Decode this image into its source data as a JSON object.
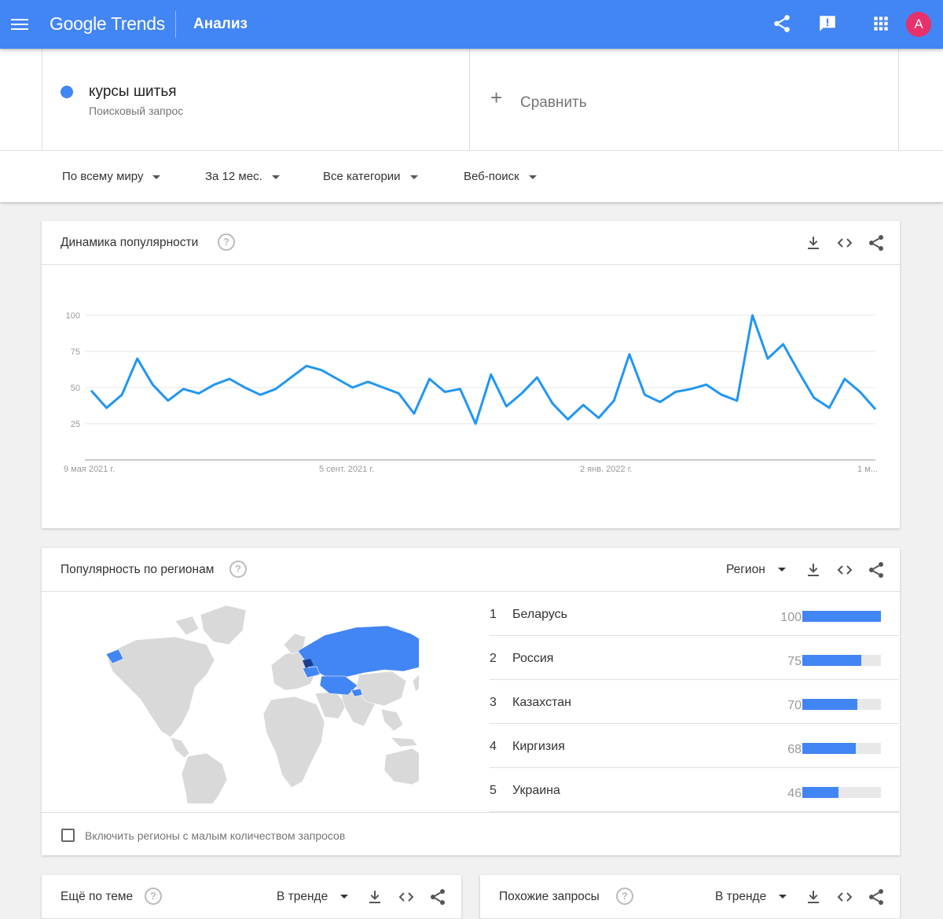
{
  "header": {
    "logo": "Google Trends",
    "section": "Анализ",
    "avatar_letter": "A",
    "icons": [
      "menu-icon",
      "share-icon",
      "feedback-icon",
      "apps-icon"
    ]
  },
  "search": {
    "term": "курсы шитья",
    "term_type": "Поисковый запрос",
    "compare_label": "Сравнить",
    "term_color": "#4285f4"
  },
  "filters": {
    "region": "По всему миру",
    "period": "За 12 мес.",
    "category": "Все категории",
    "search_type": "Веб-поиск"
  },
  "interest_over_time": {
    "title": "Динамика популярности",
    "help": "?",
    "chart_data": {
      "type": "line",
      "ylim": [
        0,
        100
      ],
      "y_ticks": [
        25,
        50,
        75,
        100
      ],
      "x_tick_labels": [
        "9 мая 2021 г.",
        "5 сент. 2021 г.",
        "2 янв. 2022 г.",
        "1 м..."
      ],
      "series": [
        {
          "color": "#2196f3",
          "values": [
            48,
            36,
            45,
            70,
            52,
            41,
            49,
            46,
            52,
            56,
            50,
            45,
            49,
            57,
            65,
            62,
            56,
            50,
            54,
            50,
            46,
            32,
            56,
            47,
            49,
            25,
            59,
            37,
            46,
            57,
            39,
            28,
            38,
            29,
            41,
            73,
            45,
            40,
            47,
            49,
            52,
            45,
            41,
            100,
            70,
            80,
            61,
            43,
            36,
            56,
            47,
            35
          ]
        }
      ]
    }
  },
  "interest_by_region": {
    "title": "Популярность по регионам",
    "help": "?",
    "resolution_label": "Регион",
    "regions": [
      {
        "rank": "1",
        "name": "Беларусь",
        "value": "100",
        "fraction": 1.0
      },
      {
        "rank": "2",
        "name": "Россия",
        "value": "75",
        "fraction": 0.75
      },
      {
        "rank": "3",
        "name": "Казахстан",
        "value": "70",
        "fraction": 0.7
      },
      {
        "rank": "4",
        "name": "Киргизия",
        "value": "68",
        "fraction": 0.68
      },
      {
        "rank": "5",
        "name": "Украина",
        "value": "46",
        "fraction": 0.46
      }
    ],
    "low_volume_label": "Включить регионы с малым количеством запросов",
    "map_colors": {
      "land": "#d9d9d9",
      "highlight": "#4285f4",
      "max": "#1a3d8f"
    }
  },
  "related_topics": {
    "title": "Ещё по теме",
    "help": "?",
    "mode": "В тренде"
  },
  "related_queries": {
    "title": "Похожие запросы",
    "help": "?",
    "mode": "В тренде"
  }
}
